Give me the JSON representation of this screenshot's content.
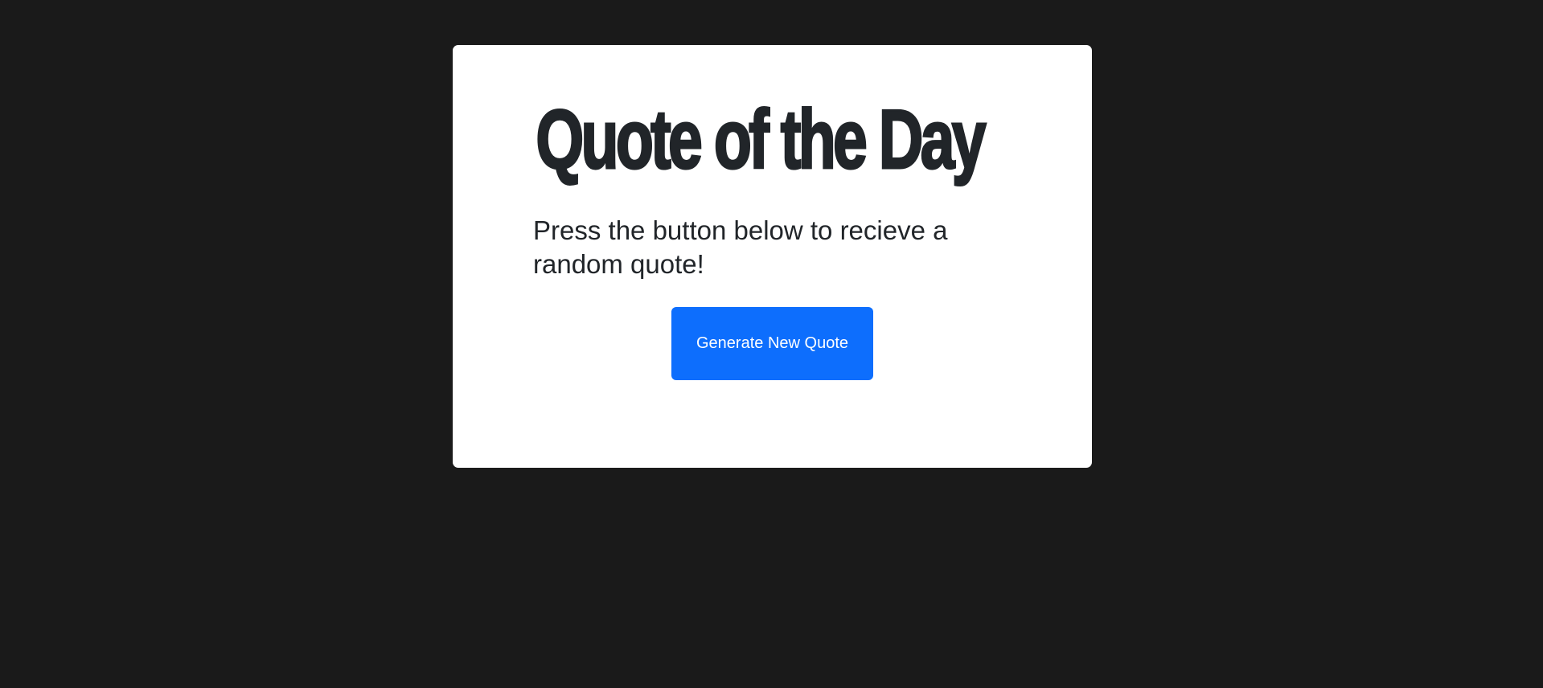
{
  "card": {
    "title": "Quote of the Day",
    "subtitle": "Press the button below to recieve a random quote!",
    "button_label": "Generate New Quote"
  },
  "colors": {
    "background": "#1a1a1a",
    "card": "#ffffff",
    "text": "#212529",
    "button": "#0d6efd",
    "button_text": "#ffffff"
  }
}
